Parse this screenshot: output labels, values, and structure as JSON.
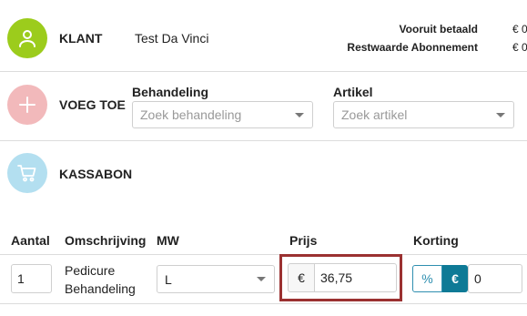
{
  "client": {
    "section_label": "KLANT",
    "name": "Test Da Vinci",
    "prepaid_label": "Vooruit betaald",
    "prepaid_value": "€ 0",
    "residual_label": "Restwaarde Abonnement",
    "residual_value": "€ 0"
  },
  "add": {
    "section_label": "VOEG TOE",
    "treatment_label": "Behandeling",
    "treatment_placeholder": "Zoek behandeling",
    "article_label": "Artikel",
    "article_placeholder": "Zoek artikel"
  },
  "receipt": {
    "section_label": "KASSABON",
    "columns": [
      "Aantal",
      "Omschrijving",
      "MW",
      "Prijs",
      "Korting"
    ],
    "rows": [
      {
        "quantity": "1",
        "description_line1": "Pedicure",
        "description_line2": "Behandeling",
        "employee": "L",
        "currency_symbol": "€",
        "price": "36,75",
        "discount_percent_label": "%",
        "discount_euro_label": "€",
        "discount_value": "0"
      }
    ]
  },
  "icons": {
    "client": "user-icon",
    "add": "plus-icon",
    "receipt": "cart-icon"
  },
  "colors": {
    "client_circle": "#9ccc1c",
    "add_circle": "#f2b9bb",
    "receipt_circle": "#b3dff0",
    "highlight_border": "#9b3131",
    "euro_toggle_active": "#0e7a96"
  }
}
